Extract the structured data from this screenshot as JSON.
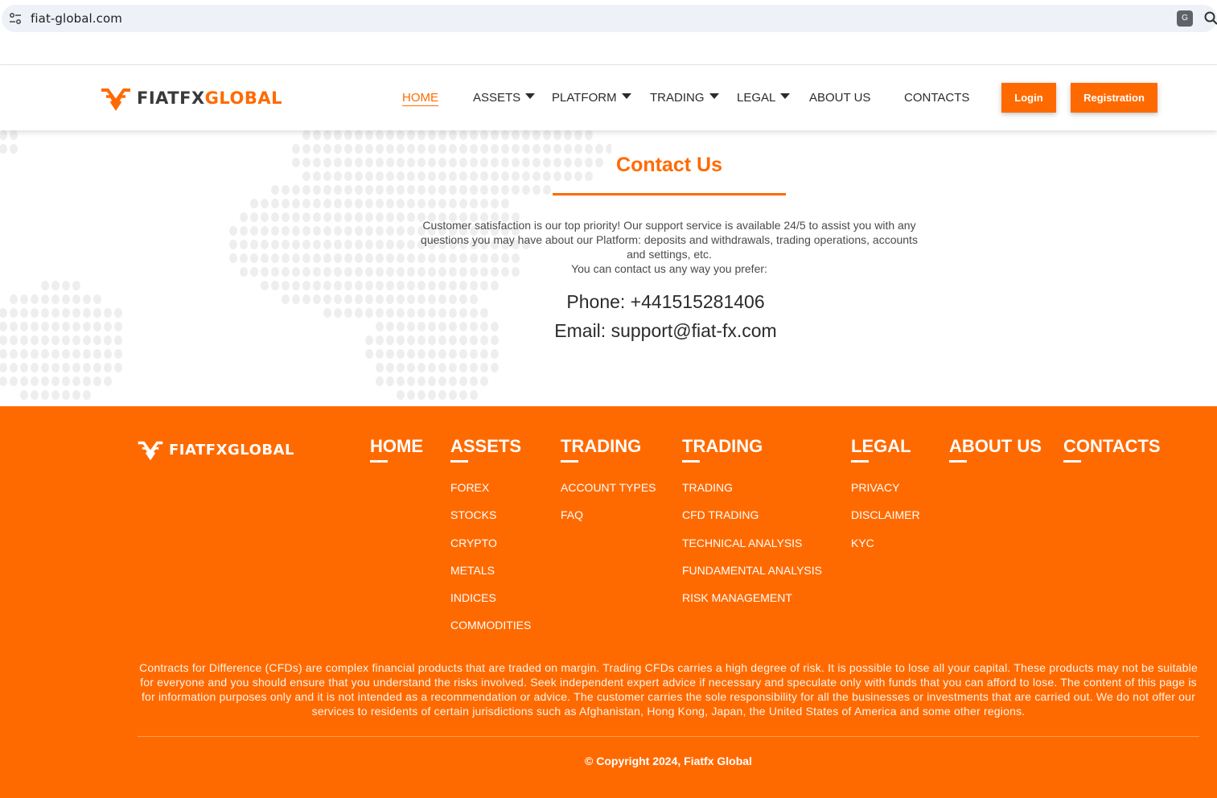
{
  "browser": {
    "url": "fiat-global.com",
    "site_info_icon": "tune-icon",
    "translate_icon": "translate-icon",
    "zoom_icon": "zoom-icon"
  },
  "brand": {
    "name_part1": "FIATFX",
    "name_part2": "GLOBAL",
    "accent_color": "#ff6a00",
    "dark_color": "#3a3a3a"
  },
  "nav": {
    "items": [
      {
        "label": "HOME",
        "active": true,
        "dropdown": false
      },
      {
        "label": "ASSETS",
        "active": false,
        "dropdown": true
      },
      {
        "label": "PLATFORM",
        "active": false,
        "dropdown": true
      },
      {
        "label": "TRADING",
        "active": false,
        "dropdown": true
      },
      {
        "label": "LEGAL",
        "active": false,
        "dropdown": true
      },
      {
        "label": "ABOUT US",
        "active": false,
        "dropdown": false
      },
      {
        "label": "CONTACTS",
        "active": false,
        "dropdown": false
      }
    ],
    "login_label": "Login",
    "register_label": "Registration"
  },
  "contact": {
    "title": "Contact Us",
    "intro": "Customer satisfaction is our top priority! Our support service is available 24/5 to assist you with any questions you may have about our Platform: deposits and withdrawals, trading operations, accounts and settings, etc.",
    "intro2": "You can contact us any way you prefer:",
    "phone": "Phone: +441515281406",
    "email": "Email: support@fiat-fx.com"
  },
  "footer": {
    "columns": [
      {
        "heading": "HOME",
        "links": []
      },
      {
        "heading": "ASSETS",
        "links": [
          "FOREX",
          "STOCKS",
          "CRYPTO",
          "METALS",
          "INDICES",
          "COMMODITIES"
        ]
      },
      {
        "heading": "TRADING",
        "links": [
          "ACCOUNT TYPES",
          "FAQ"
        ]
      },
      {
        "heading": "TRADING",
        "links": [
          "TRADING",
          "CFD TRADING",
          "TECHNICAL ANALYSIS",
          "FUNDAMENTAL ANALYSIS",
          "RISK MANAGEMENT"
        ]
      },
      {
        "heading": "LEGAL",
        "links": [
          "PRIVACY",
          "DISCLAIMER",
          "KYC"
        ]
      },
      {
        "heading": "ABOUT US",
        "links": []
      },
      {
        "heading": "CONTACTS",
        "links": []
      }
    ],
    "disclaimer": "Contracts for Difference (CFDs) are complex financial products that are traded on margin. Trading CFDs carries a high degree of risk. It is possible to lose all your capital. These products may not be suitable for everyone and you should ensure that you understand the risks involved. Seek independent expert advice if necessary and speculate only with funds that you can afford to lose. The content of this page is for information purposes only and it is not intended as a recommendation or advice. The customer carries the sole responsibility for all the businesses or investments that are carried out. We do not offer our services to residents of certain jurisdictions such as Afghanistan, Hong Kong, Japan, the United States of America and some other regions.",
    "copyright": "© Copyright 2024, Fiatfx Global"
  }
}
